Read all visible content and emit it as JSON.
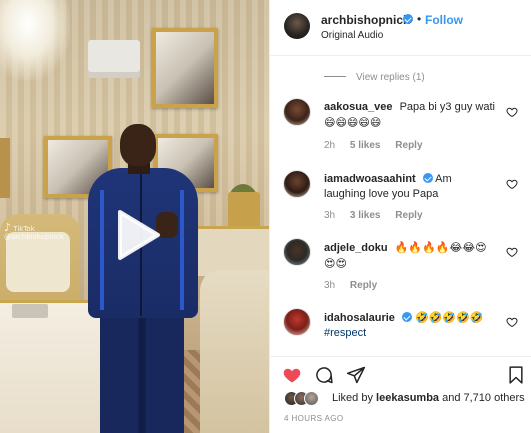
{
  "post": {
    "author": "archbishopnick",
    "separator": "•",
    "follow_label": "Follow",
    "audio": "Original Audio"
  },
  "media": {
    "watermark_text": "TikTok",
    "watermark_handle": "@archbishopnick"
  },
  "comments_section": {
    "view_replies": "View replies (1)",
    "comments": [
      {
        "username": "aakosua_vee",
        "text": "Papa bi y3 guy wati",
        "emojis": "😄😄😄😄😄",
        "time": "2h",
        "likes": "5 likes",
        "reply": "Reply",
        "verified": false
      },
      {
        "username": "iamadwoasaahint",
        "text": "Am laughing love you Papa",
        "emojis": "",
        "time": "3h",
        "likes": "3 likes",
        "reply": "Reply",
        "verified": true
      },
      {
        "username": "adjele_doku",
        "text": "",
        "emojis": "🔥🔥🔥🔥😂😂😍😍😍",
        "time": "3h",
        "likes": "",
        "reply": "Reply",
        "verified": false
      },
      {
        "username": "idahosalaurie",
        "text": "#respect",
        "emojis": "🤣🤣🤣🤣🤣",
        "time": "",
        "likes": "",
        "reply": "",
        "verified": true
      }
    ]
  },
  "engagement": {
    "liked_by_prefix": "Liked by",
    "liked_by_user": "leekasumba",
    "liked_by_suffix": "and 7,710 others",
    "timestamp": "4 HOURS AGO"
  },
  "icons": {
    "like": "heart-icon",
    "comment": "comment-icon",
    "share": "share-icon",
    "save": "bookmark-icon",
    "play": "play-icon"
  },
  "colors": {
    "link": "#3897f0",
    "like_red": "#ed4956",
    "muted": "#8e8e8e",
    "text": "#262626"
  }
}
